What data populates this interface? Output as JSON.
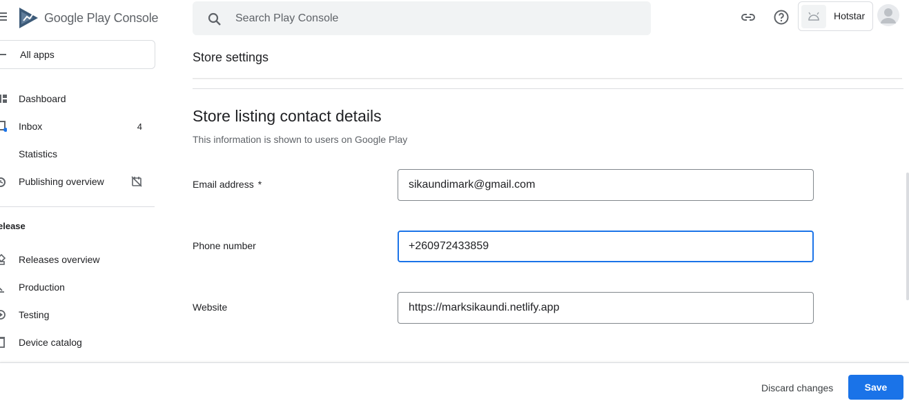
{
  "brand": {
    "logo_text": "Google Play Console",
    "accent_color": "#1a73e8"
  },
  "search": {
    "placeholder": "Search Play Console",
    "value": ""
  },
  "top_bar": {
    "app_name": "Hotstar"
  },
  "sidebar": {
    "all_apps_label": "All apps",
    "items": [
      {
        "label": "Dashboard",
        "icon": "dashboard-icon"
      },
      {
        "label": "Inbox",
        "icon": "inbox-icon",
        "count": "4"
      },
      {
        "label": "Statistics",
        "icon": "statistics-icon"
      },
      {
        "label": "Publishing overview",
        "icon": "publishing-overview-icon"
      }
    ],
    "section_heading": "elease",
    "release_items": [
      {
        "label": "Releases overview",
        "icon": "releases-overview-icon"
      },
      {
        "label": "Production",
        "icon": "production-icon"
      },
      {
        "label": "Testing",
        "icon": "testing-icon"
      },
      {
        "label": "Device catalog",
        "icon": "device-catalog-icon"
      }
    ]
  },
  "main": {
    "page_title": "Store settings",
    "section_title": "Store listing contact details",
    "section_description": "This information is shown to users on Google Play",
    "fields": [
      {
        "label": "Email address",
        "required_mark": "*",
        "value": "sikaundimark@gmail.com"
      },
      {
        "label": "Phone number",
        "value": "+260972433859",
        "focused": true
      },
      {
        "label": "Website",
        "value": "https://marksikaundi.netlify.app"
      }
    ]
  },
  "footer": {
    "discard_label": "Discard changes",
    "save_label": "Save"
  }
}
